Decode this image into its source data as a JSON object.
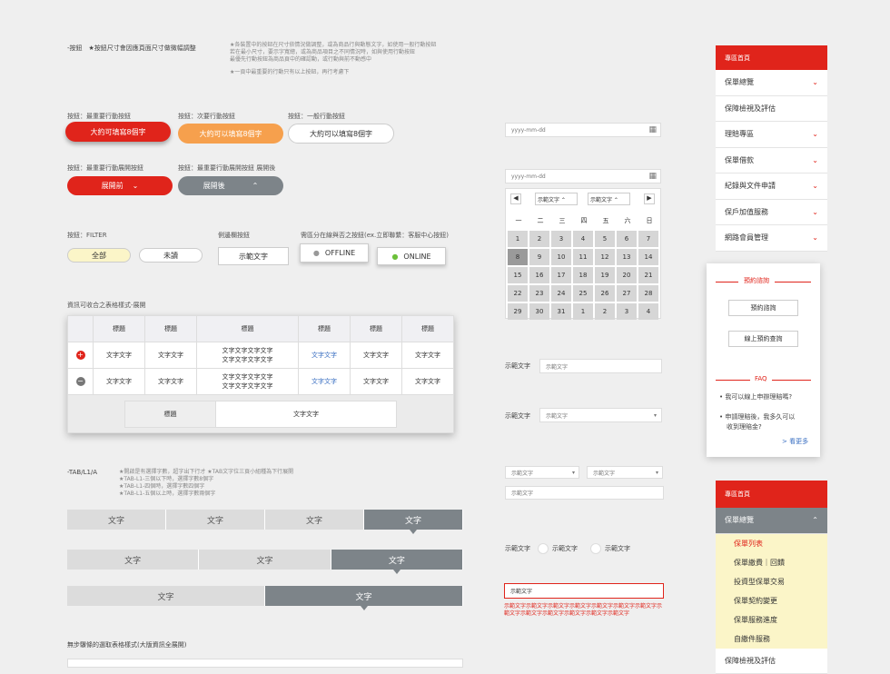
{
  "intro": {
    "title": "-按鈕　★按鈕尺寸會因應頁面尺寸做微幅調整",
    "notes": [
      "★各裝置中的按鈕在尺寸依情況做調整，或為商品行與動態文字，如使用一般行動按鈕",
      "若在最小尺寸，要示字寬總，或為商品項目之不同情況時，如與使用行動按鈕",
      "最優先行動按鈕為商品頁中的確認動，或行動與前不動感中",
      "★一頁中最重要的行動只有以上按鈕，再行考慮下"
    ]
  },
  "buttons": {
    "primary_label": "按鈕：最重要行動按鈕",
    "secondary_label": "按鈕：次要行動按鈕",
    "general_label": "按鈕：一般行動按鈕",
    "primary": "大約可填寫8個字",
    "secondary": "大約可以填寫8個字",
    "general": "大約可以填寫8個字",
    "exp_label1": "按鈕：最重要行動展開按鈕",
    "exp_label2": "按鈕：最重要行動展開按鈕 展開後",
    "expand": "展開前",
    "expanded": "展開後"
  },
  "filter": {
    "label": "按鈕：FILTER",
    "all": "全部",
    "unread": "未讀",
    "side_label": "側邊欄按鈕",
    "side": "示範文字",
    "online_label": "需區分在線與否之按鈕(ex.立即聯繫：客服中心按鈕)",
    "offline": "OFFLINE",
    "online": "ONLINE"
  },
  "table": {
    "caption": "資訊可收合之表格樣式-展開",
    "headers": [
      "標題",
      "標題",
      "標題",
      "標題",
      "標題",
      "標題"
    ],
    "cell": "文字文字",
    "cell2": "文字文字文字文字",
    "link": "文字文字",
    "sub_header": "標題",
    "sub_cell": "文字文字"
  },
  "tabs": {
    "title": "-TAB/L1/A",
    "notes": [
      "★開啟是有選擇字數，超字出下行才 ★TAB文字位三頁小組種為下行展開",
      "★TAB-L1-三個以下時，選擇字數8個字",
      "★TAB-L1-四個時，選擇字數四個字",
      "★TAB-L1-五個以上時，選擇字數兩個字"
    ],
    "label": "文字"
  },
  "bottom_title": "無步驟條的選取表格樣式(大版資訊全展開)",
  "date": {
    "placeholder1": "yyyy-mm-dd",
    "placeholder2": "yyyy-mm-dd",
    "sel1": "示範文字",
    "sel2": "示範文字",
    "weekdays": [
      "一",
      "二",
      "三",
      "四",
      "五",
      "六",
      "日"
    ],
    "days": [
      "1",
      "2",
      "3",
      "4",
      "5",
      "6",
      "7",
      "8",
      "9",
      "10",
      "11",
      "12",
      "13",
      "14",
      "15",
      "16",
      "17",
      "18",
      "19",
      "20",
      "21",
      "22",
      "23",
      "24",
      "25",
      "26",
      "27",
      "28",
      "29",
      "30",
      "31",
      "1",
      "2",
      "3",
      "4"
    ]
  },
  "form": {
    "label": "示範文字",
    "input": "示範文字",
    "select": "示範文字",
    "sel_a": "示範文字",
    "sel_b": "示範文字",
    "input2": "示範文字",
    "radio_label": "示範文字",
    "r1": "示範文字",
    "r2": "示範文字",
    "error_input": "示範文字",
    "error_msg": "示範文字示範文字示範文字示範文字示範文字示範文字示範文字示範文字示範文字示範文字示範文字示範文字示範文字"
  },
  "menu": {
    "header": "專區首頁",
    "items": [
      "保單總覽",
      "保障檢視及評估",
      "理賠專區",
      "保單借款",
      "紀錄與文件申請",
      "保戶加值服務",
      "網路會員管理"
    ]
  },
  "popup": {
    "title": "預約諮詢",
    "btn1": "預約諮詢",
    "btn2": "線上預約查詢",
    "faq": "FAQ",
    "q1": "我可以線上申辦理賠嗎?",
    "q2a": "申請理賠後，我多久可以",
    "q2b": "收到理賠金?",
    "more": "> 看更多"
  },
  "menu2": {
    "header": "專區首頁",
    "open": "保單總覽",
    "subs": [
      "保單列表",
      "保單繳費｜回饋",
      "投資型保單交易",
      "保單契約變更",
      "保單服務進度",
      "自繳件服務"
    ],
    "next": "保障檢視及評估"
  }
}
